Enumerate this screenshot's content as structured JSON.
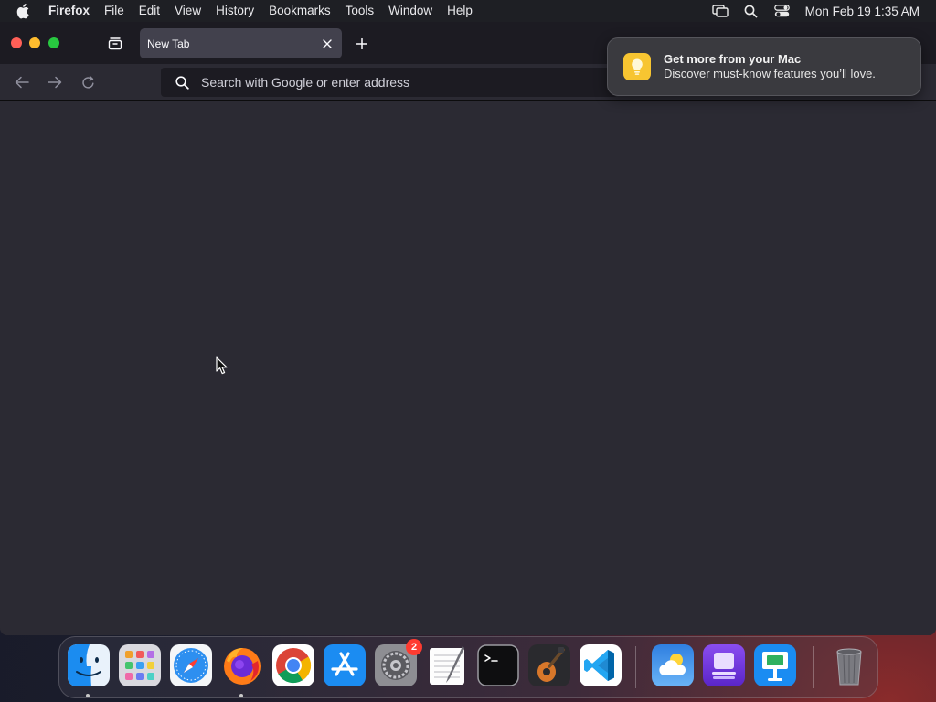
{
  "menubar": {
    "app_name": "Firefox",
    "items": [
      "File",
      "Edit",
      "View",
      "History",
      "Bookmarks",
      "Tools",
      "Window",
      "Help"
    ],
    "clock": "Mon Feb 19  1:35 AM"
  },
  "browser": {
    "tabs": [
      {
        "title": "New Tab",
        "active": true
      }
    ],
    "urlbar": {
      "placeholder": "Search with Google or enter address",
      "value": ""
    }
  },
  "notification": {
    "title": "Get more from your Mac",
    "body": "Discover must-know features you’ll love.",
    "icon": "lightbulb-icon"
  },
  "dock": {
    "apps": [
      {
        "name": "Finder",
        "icon": "finder-icon",
        "running": true
      },
      {
        "name": "Launchpad",
        "icon": "launchpad-icon",
        "running": false
      },
      {
        "name": "Safari",
        "icon": "safari-icon",
        "running": false
      },
      {
        "name": "Firefox",
        "icon": "firefox-icon",
        "running": true
      },
      {
        "name": "Google Chrome",
        "icon": "chrome-icon",
        "running": false
      },
      {
        "name": "App Store",
        "icon": "app-store-icon",
        "running": false
      },
      {
        "name": "System Settings",
        "icon": "settings-icon",
        "running": false,
        "badge": "2"
      },
      {
        "name": "TextEdit",
        "icon": "textedit-icon",
        "running": false
      },
      {
        "name": "Terminal",
        "icon": "terminal-icon",
        "running": false
      },
      {
        "name": "GarageBand",
        "icon": "garageband-icon",
        "running": false
      },
      {
        "name": "Visual Studio Code",
        "icon": "vscode-icon",
        "running": false
      },
      {
        "name": "Weather",
        "icon": "weather-icon",
        "running": false
      },
      {
        "name": "Apple Configurator",
        "icon": "configurator-icon",
        "running": false
      },
      {
        "name": "Keynote",
        "icon": "keynote-icon",
        "running": false
      },
      {
        "name": "Trash",
        "icon": "trash-icon",
        "running": false
      }
    ]
  },
  "colors": {
    "menubar_bg": "#1e1f24",
    "tabbar_bg": "#1c1b22",
    "content_bg": "#2b2a33",
    "active_tab_bg": "#42414d",
    "urlbar_bg": "#1c1b22",
    "close": "#ff5f57",
    "minimize": "#febc2e",
    "maximize": "#28c840",
    "badge": "#ff3b30"
  }
}
